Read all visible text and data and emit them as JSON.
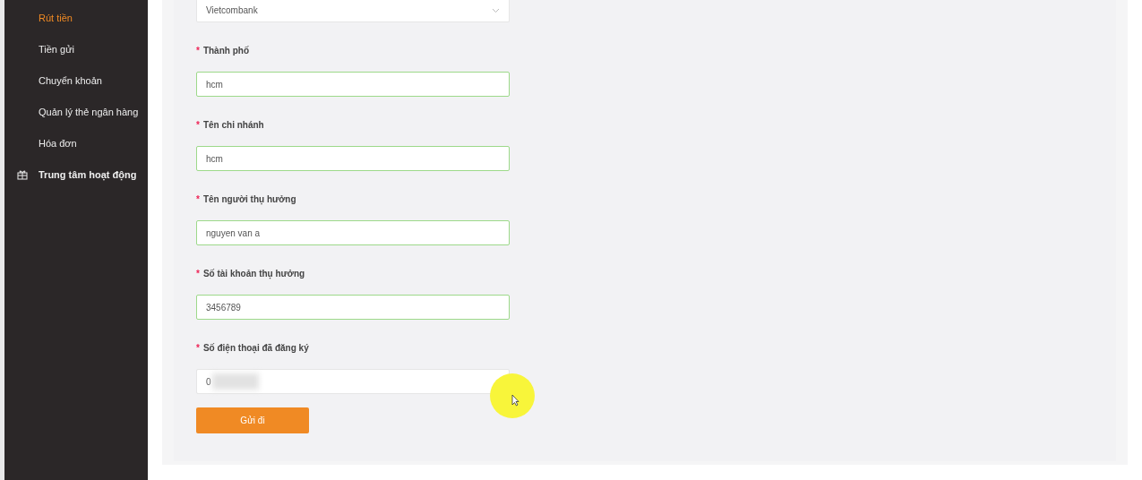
{
  "sidebar": {
    "items": [
      {
        "label": "Rút tiền",
        "selected": true,
        "kind": "sub"
      },
      {
        "label": "Tiền gửi",
        "selected": false,
        "kind": "sub"
      },
      {
        "label": "Chuyển khoản",
        "selected": false,
        "kind": "sub"
      },
      {
        "label": "Quản lý thẻ ngân hàng",
        "selected": false,
        "kind": "sub"
      },
      {
        "label": "Hóa đơn",
        "selected": false,
        "kind": "sub"
      },
      {
        "label": "Trung tâm hoạt động",
        "selected": false,
        "kind": "section"
      }
    ]
  },
  "form": {
    "bank_select": {
      "value": "Vietcombank"
    },
    "fields": [
      {
        "mark": "*",
        "label": "Thành phố",
        "value": "hcm",
        "valid": true
      },
      {
        "mark": "*",
        "label": "Tên chi nhánh",
        "value": "hcm",
        "valid": true
      },
      {
        "mark": "*",
        "label": "Tên người thụ hưởng",
        "value": "nguyen van a",
        "valid": true
      },
      {
        "mark": "*",
        "label": "Số tài khoản thụ hưởng",
        "value": "3456789",
        "valid": true
      },
      {
        "mark": "*",
        "label": "Số điện thoại đã đăng ký",
        "value": "0",
        "valid": false,
        "redacted": true
      }
    ],
    "submit": "Gửi đi"
  }
}
